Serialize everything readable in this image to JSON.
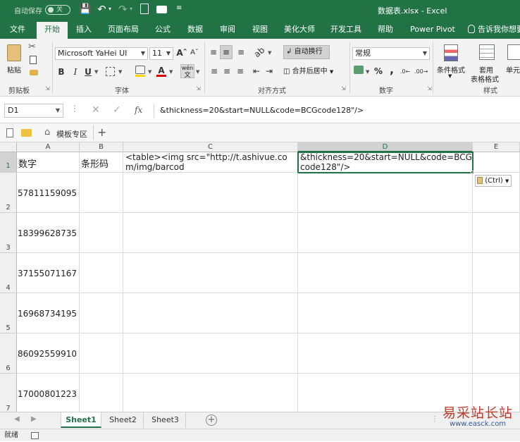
{
  "titlebar": {
    "autosave_label": "自动保存",
    "autosave_state": "关",
    "title": "数据表.xlsx - Excel"
  },
  "tabs": [
    "文件",
    "开始",
    "插入",
    "页面布局",
    "公式",
    "数据",
    "审阅",
    "视图",
    "美化大师",
    "开发工具",
    "帮助",
    "Power Pivot",
    "告诉我你想要"
  ],
  "active_tab": "开始",
  "ribbon": {
    "paste": "粘贴",
    "clipboard_label": "剪贴板",
    "font_name": "Microsoft YaHei UI",
    "font_size": "11",
    "font_group_label": "字体",
    "wrap_text": "自动换行",
    "merge_center": "合并后居中",
    "alignment_label": "对齐方式",
    "number_format": "常规",
    "number_label": "数字",
    "percent": "%",
    "comma": ",",
    "conditional_format": "条件格式",
    "table_format_1": "套用",
    "table_format_2": "表格格式",
    "cell_styles": "单元",
    "styles_label": "样式",
    "bold": "B",
    "italic": "I",
    "underline": "U",
    "font_color_letter": "A",
    "phonetic": "wén"
  },
  "formula_bar": {
    "name_box": "D1",
    "fx": "fx",
    "content": "&thickness=20&start=NULL&code=BCGcode128\"/>"
  },
  "quickbar": {
    "template_label": "模板专区",
    "add": "+"
  },
  "columns": [
    "A",
    "B",
    "C",
    "D",
    "E"
  ],
  "rows": [
    {
      "num": "1",
      "a": "数字",
      "b": "条形码",
      "c": "<table><img src=\"http://t.ashivue.com/img/barcod",
      "d": "&thickness=20&start=NULL&code=BCGcode128\"/>"
    },
    {
      "num": "2",
      "a": "57811159095",
      "b": "",
      "c": "",
      "d": ""
    },
    {
      "num": "3",
      "a": "18399628735",
      "b": "",
      "c": "",
      "d": ""
    },
    {
      "num": "4",
      "a": "37155071167",
      "b": "",
      "c": "",
      "d": ""
    },
    {
      "num": "5",
      "a": "16968734195",
      "b": "",
      "c": "",
      "d": ""
    },
    {
      "num": "6",
      "a": "86092559910",
      "b": "",
      "c": "",
      "d": ""
    },
    {
      "num": "7",
      "a": "17000801223",
      "b": "",
      "c": "",
      "d": ""
    }
  ],
  "paste_options": "(Ctrl)",
  "sheets": [
    "Sheet1",
    "Sheet2",
    "Sheet3"
  ],
  "active_sheet": "Sheet1",
  "status": "就绪",
  "watermark": "易采站长站",
  "watermark_url": "www.easck.com",
  "colors": {
    "brand": "#217346",
    "selection": "#217346"
  }
}
